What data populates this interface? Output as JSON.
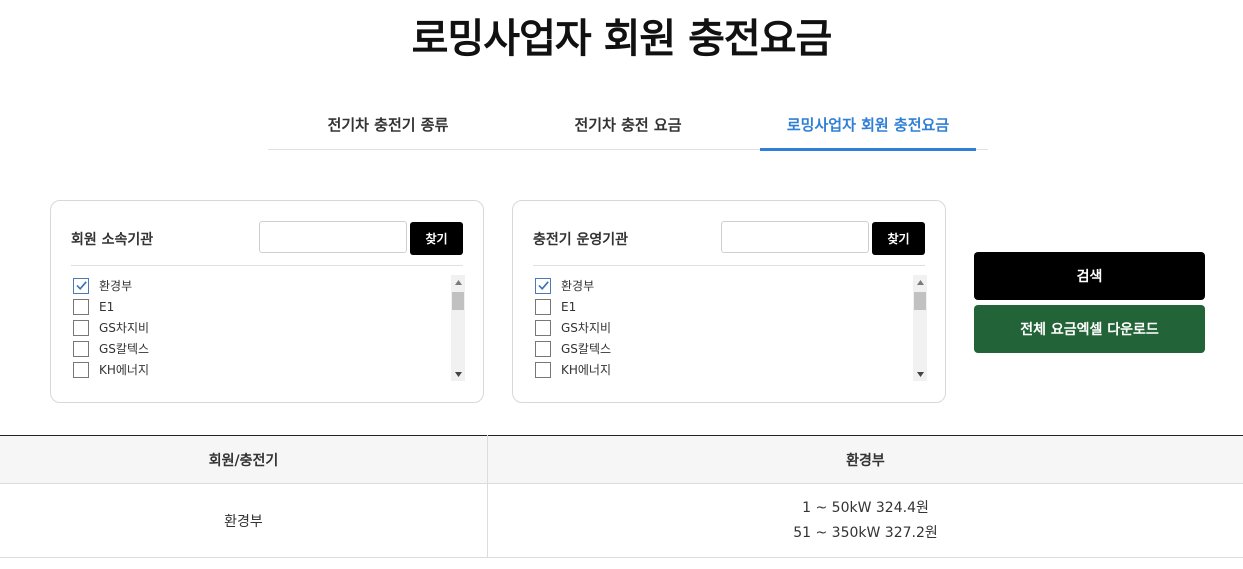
{
  "page": {
    "title": "로밍사업자 회원 충전요금"
  },
  "tabs": [
    {
      "label": "전기차 충전기 종류",
      "active": false
    },
    {
      "label": "전기차 충전 요금",
      "active": false
    },
    {
      "label": "로밍사업자 회원 충전요금",
      "active": true
    }
  ],
  "member_panel": {
    "title": "회원 소속기관",
    "search_value": "",
    "find_label": "찾기",
    "items": [
      {
        "label": "환경부",
        "checked": true
      },
      {
        "label": "E1",
        "checked": false
      },
      {
        "label": "GS차지비",
        "checked": false
      },
      {
        "label": "GS칼텍스",
        "checked": false
      },
      {
        "label": "KH에너지",
        "checked": false
      }
    ]
  },
  "operator_panel": {
    "title": "충전기 운영기관",
    "search_value": "",
    "find_label": "찾기",
    "items": [
      {
        "label": "환경부",
        "checked": true
      },
      {
        "label": "E1",
        "checked": false
      },
      {
        "label": "GS차지비",
        "checked": false
      },
      {
        "label": "GS칼텍스",
        "checked": false
      },
      {
        "label": "KH에너지",
        "checked": false
      }
    ]
  },
  "actions": {
    "search_label": "검색",
    "excel_label": "전체 요금엑셀 다운로드"
  },
  "result_table": {
    "headers": [
      "회원/충전기",
      "환경부"
    ],
    "rows": [
      {
        "member": "환경부",
        "rates": [
          "1 ~ 50kW 324.4원",
          "51 ~ 350kW 327.2원"
        ]
      }
    ]
  },
  "colors": {
    "accent": "#2f7fd6",
    "excel_button": "#226337",
    "search_button": "#000000"
  }
}
